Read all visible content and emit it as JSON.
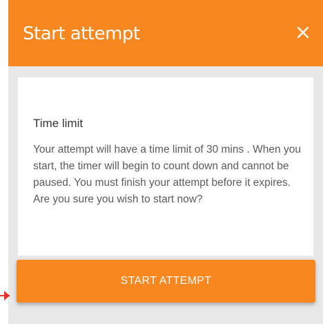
{
  "dialog": {
    "title": "Start attempt",
    "close_icon": "close-icon"
  },
  "content": {
    "heading": "Time limit",
    "body": "Your attempt will have a time limit of 30 mins . When you start, the timer will begin to count down and cannot be paused. You must finish your attempt before it expires. Are you sure you wish to start now?"
  },
  "actions": {
    "start_label": "START ATTEMPT"
  },
  "colors": {
    "accent": "#f7871e",
    "pointer": "#e5332a",
    "backdrop": "#e8e8e8"
  }
}
